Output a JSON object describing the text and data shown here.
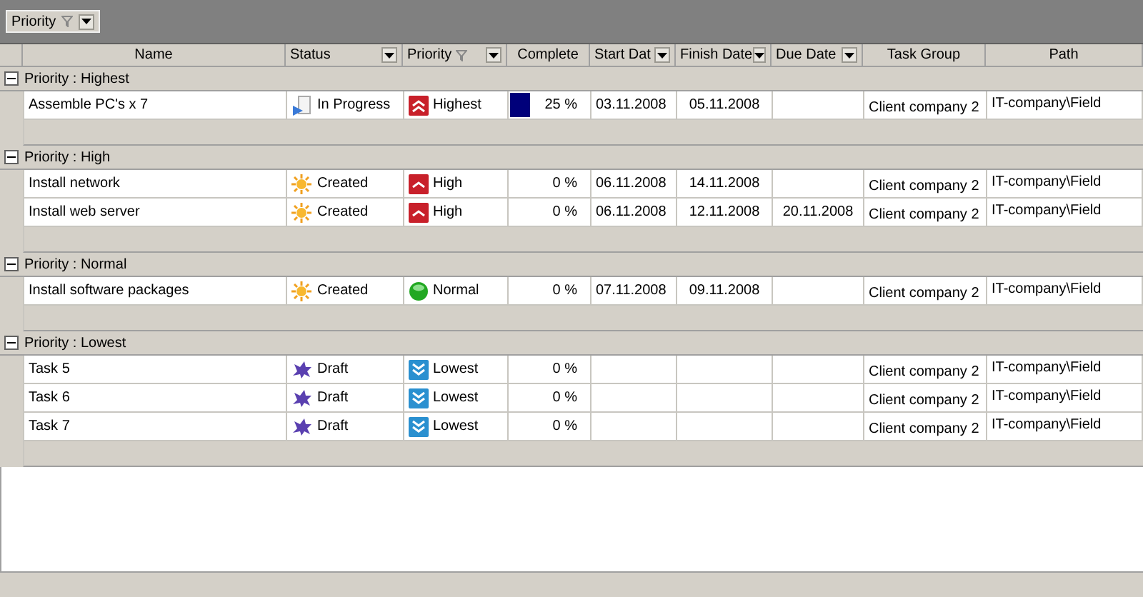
{
  "group_by": {
    "label": "Priority"
  },
  "columns": [
    {
      "label": "Name",
      "dropdown": false,
      "filter": false
    },
    {
      "label": "Status",
      "dropdown": true,
      "filter": false
    },
    {
      "label": "Priority",
      "dropdown": true,
      "filter": true
    },
    {
      "label": "Complete",
      "dropdown": false,
      "filter": false
    },
    {
      "label": "Start Dat",
      "dropdown": true,
      "filter": false
    },
    {
      "label": "Finish Date",
      "dropdown": true,
      "filter": false
    },
    {
      "label": "Due Date",
      "dropdown": true,
      "filter": false
    },
    {
      "label": "Task Group",
      "dropdown": false,
      "filter": false
    },
    {
      "label": "Path",
      "dropdown": false,
      "filter": false
    }
  ],
  "groups": [
    {
      "label": "Priority : Highest",
      "expanded": true,
      "rows": [
        {
          "name": "Assemble PC's x 7",
          "status": {
            "kind": "progress",
            "label": "In Progress"
          },
          "priority": {
            "kind": "highest",
            "label": "Highest"
          },
          "complete": {
            "level": 0.25,
            "text": "25 %"
          },
          "start": "03.11.2008",
          "finish": "05.11.2008",
          "due": "",
          "task_group": "Client company 2",
          "path": "IT-company\\Field"
        }
      ]
    },
    {
      "label": "Priority : High",
      "expanded": true,
      "rows": [
        {
          "name": "Install network",
          "status": {
            "kind": "created",
            "label": "Created"
          },
          "priority": {
            "kind": "high",
            "label": "High"
          },
          "complete": {
            "level": 0,
            "text": "0 %"
          },
          "start": "06.11.2008",
          "finish": "14.11.2008",
          "due": "",
          "task_group": "Client company 2",
          "path": "IT-company\\Field"
        },
        {
          "name": "Install web server",
          "status": {
            "kind": "created",
            "label": "Created"
          },
          "priority": {
            "kind": "high",
            "label": "High"
          },
          "complete": {
            "level": 0,
            "text": "0 %"
          },
          "start": "06.11.2008",
          "finish": "12.11.2008",
          "due": "20.11.2008",
          "task_group": "Client company 2",
          "path": "IT-company\\Field"
        }
      ]
    },
    {
      "label": "Priority : Normal",
      "expanded": true,
      "rows": [
        {
          "name": "Install software packages",
          "status": {
            "kind": "created",
            "label": "Created"
          },
          "priority": {
            "kind": "normal",
            "label": "Normal"
          },
          "complete": {
            "level": 0,
            "text": "0 %"
          },
          "start": "07.11.2008",
          "finish": "09.11.2008",
          "due": "",
          "task_group": "Client company 2",
          "path": "IT-company\\Field"
        }
      ]
    },
    {
      "label": "Priority : Lowest",
      "expanded": true,
      "rows": [
        {
          "name": "Task 5",
          "status": {
            "kind": "draft",
            "label": "Draft"
          },
          "priority": {
            "kind": "lowest",
            "label": "Lowest"
          },
          "complete": {
            "level": 0,
            "text": "0 %"
          },
          "start": "",
          "finish": "",
          "due": "",
          "task_group": "Client company 2",
          "path": "IT-company\\Field"
        },
        {
          "name": "Task 6",
          "status": {
            "kind": "draft",
            "label": "Draft"
          },
          "priority": {
            "kind": "lowest",
            "label": "Lowest"
          },
          "complete": {
            "level": 0,
            "text": "0 %"
          },
          "start": "",
          "finish": "",
          "due": "",
          "task_group": "Client company 2",
          "path": "IT-company\\Field"
        },
        {
          "name": "Task 7",
          "status": {
            "kind": "draft",
            "label": "Draft"
          },
          "priority": {
            "kind": "lowest",
            "label": "Lowest"
          },
          "complete": {
            "level": 0,
            "text": "0 %"
          },
          "start": "",
          "finish": "",
          "due": "",
          "task_group": "Client company 2",
          "path": "IT-company\\Field"
        }
      ]
    }
  ]
}
